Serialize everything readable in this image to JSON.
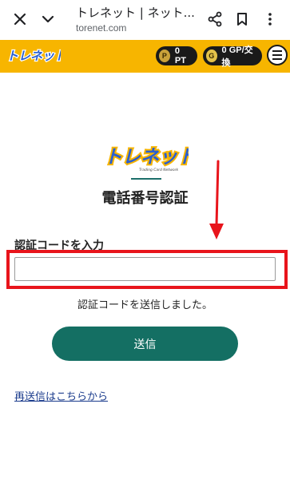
{
  "browser": {
    "title": "トレネット | ネット...",
    "url": "torenet.com"
  },
  "header": {
    "logo_text": "トレネット",
    "points": "0 PT",
    "gp": "0 GP/交換"
  },
  "main": {
    "logo_text": "トレネット",
    "logo_subtext": "Trading Card Network",
    "title": "電話番号認証",
    "field_label": "認証コードを入力",
    "input_value": "",
    "sent_message": "認証コードを送信しました。",
    "send_button": "送信",
    "resend_link": "再送信はこちらから"
  },
  "colors": {
    "header_bg": "#f7b500",
    "button": "#146f63",
    "highlight": "#e8141b",
    "link": "#1a3b8c"
  },
  "icons": [
    "close-icon",
    "chevron-down-icon",
    "share-icon",
    "bookmark-icon",
    "more-vert-icon",
    "hamburger-menu-icon"
  ]
}
